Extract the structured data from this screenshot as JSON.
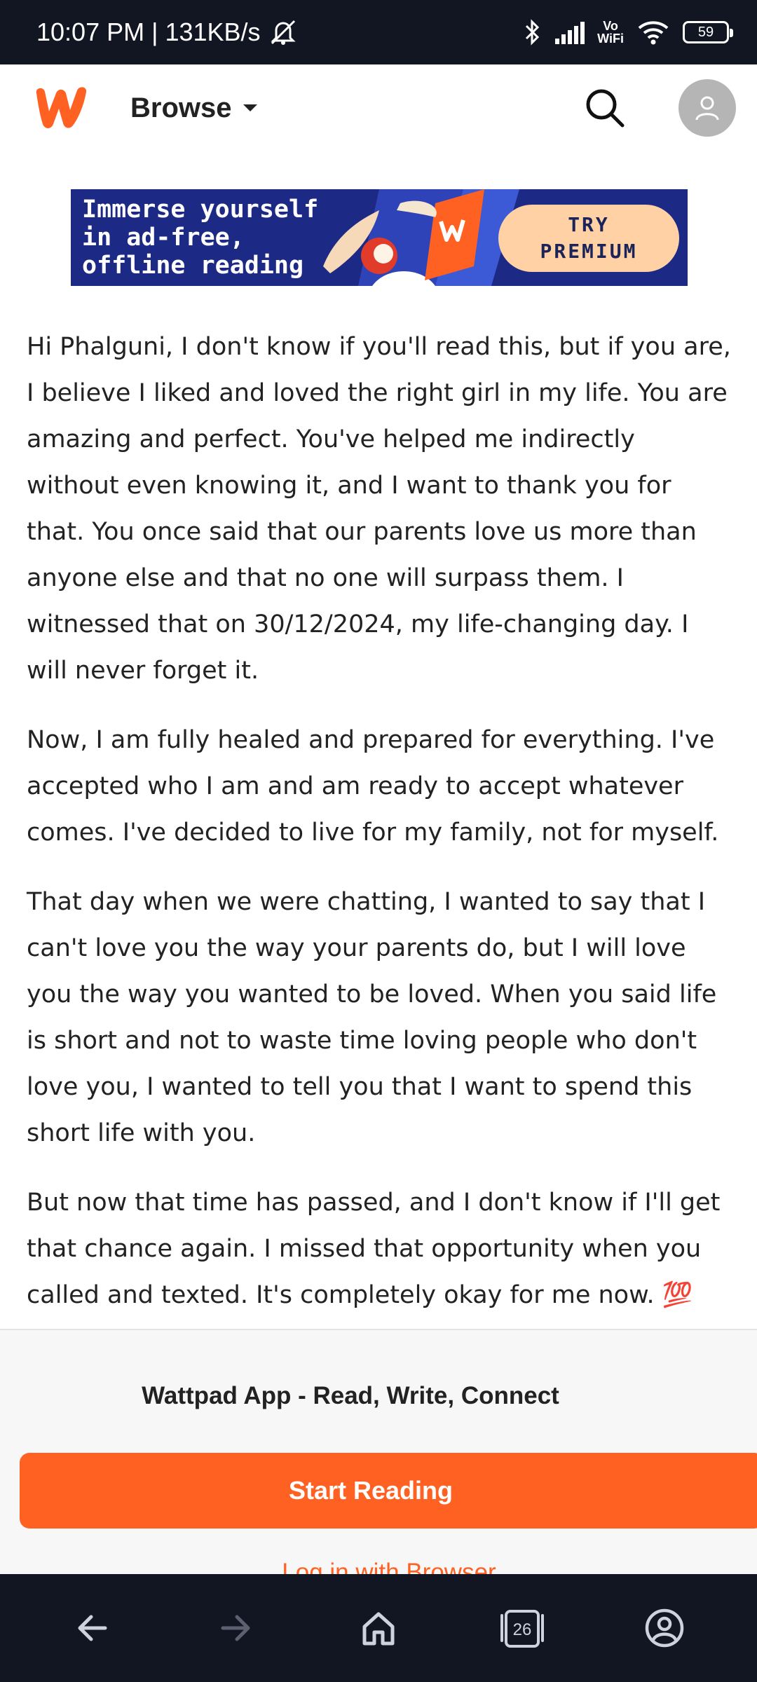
{
  "status_bar": {
    "time": "10:07 PM",
    "speed": "131KB/s",
    "separator": "|",
    "volte_top": "Vo",
    "volte_bottom": "WiFi",
    "battery": "59"
  },
  "header": {
    "browse_label": "Browse",
    "logo_icon": "wattpad-logo-icon",
    "brand_color": "#ff6122"
  },
  "promo": {
    "line1": "Immerse yourself",
    "line2": "in ad-free,",
    "line3": "offline reading",
    "cta_line1": "TRY",
    "cta_line2": "PREMIUM"
  },
  "story": {
    "paragraphs": [
      "Hi Phalguni, I don't know if you'll read this, but if you are, I believe I liked and loved the right girl in my life. You are amazing and perfect. You've helped me indirectly without even knowing it, and I want to thank you for that. You once said that our parents love us more than anyone else and that no one will surpass them. I witnessed that on 30/12/2024, my life-changing day. I will never forget it.",
      "Now, I am fully healed and prepared for everything. I've accepted who I am and am ready to accept whatever comes. I've decided to live for my family, not for myself.",
      "That day when we were chatting, I wanted to say that I can't love you the way your parents do, but I will love you the way you wanted to be loved. When you said life is short and not to waste time loving people who don't love you, I wanted to tell you that I want to spend this short life with you.",
      "But now that time has passed, and I don't know if I'll get that chance again. I missed that opportunity when you called and texted. It's completely okay for me now. 💯"
    ]
  },
  "sheet": {
    "title": "Wattpad App - Read, Write, Connect",
    "start_button": "Start Reading",
    "login_link": "Log in with Browser"
  },
  "nav_bar": {
    "tabs_count": "26"
  }
}
